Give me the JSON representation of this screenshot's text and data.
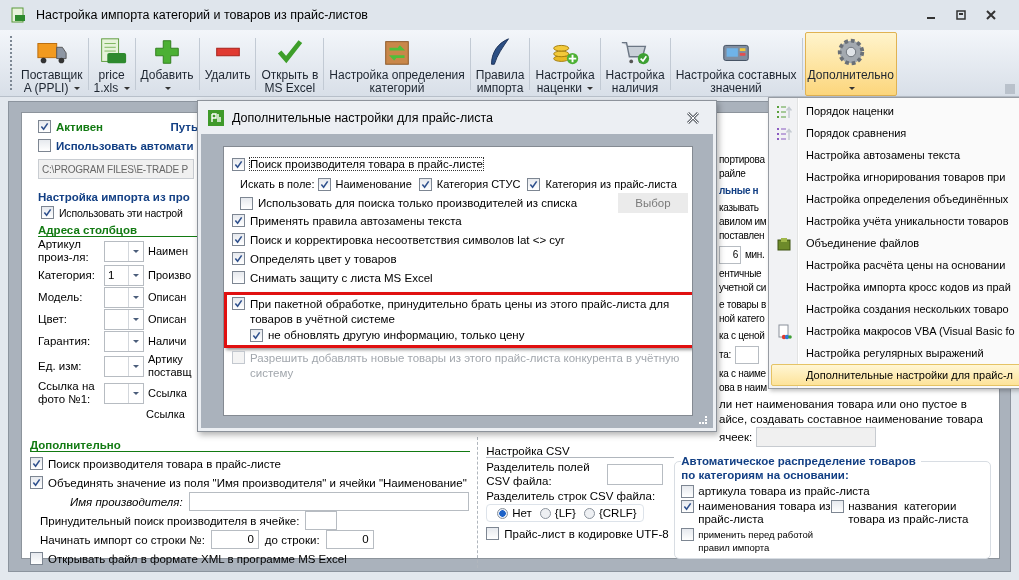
{
  "window": {
    "title": "Настройка импорта категорий и товаров из прайс-листов"
  },
  "toolbar": [
    {
      "lines": [
        "Поставщик",
        "A (PPLI)"
      ],
      "has_menu": true,
      "selected": false
    },
    {
      "lines": [
        "price",
        "1.xls"
      ],
      "has_menu": true,
      "selected": false
    },
    {
      "lines": [
        "Добавить"
      ],
      "has_menu": true,
      "selected": false
    },
    {
      "lines": [
        "Удалить"
      ],
      "has_menu": false,
      "selected": false
    },
    {
      "lines": [
        "Открыть в",
        "MS Excel"
      ],
      "has_menu": false,
      "selected": false
    },
    {
      "lines": [
        "Настройка определения",
        "категорий"
      ],
      "has_menu": false,
      "selected": false
    },
    {
      "lines": [
        "Правила",
        "импорта"
      ],
      "has_menu": false,
      "selected": false
    },
    {
      "lines": [
        "Настройка",
        "наценки"
      ],
      "has_menu": true,
      "selected": false
    },
    {
      "lines": [
        "Настройка",
        "наличия"
      ],
      "has_menu": false,
      "selected": false
    },
    {
      "lines": [
        "Настройка составных",
        "значений"
      ],
      "has_menu": false,
      "selected": false
    },
    {
      "lines": [
        "Дополнительно"
      ],
      "has_menu": true,
      "selected": true
    }
  ],
  "form": {
    "active": {
      "label": "Активен",
      "checked": true
    },
    "path_label": "Путь",
    "auto": {
      "label": "Использовать автомати",
      "checked": false,
      "path": "C:\\PROGRAM FILES\\E-TRADE P"
    },
    "import_title": "Настройка импорта из про",
    "use_settings": {
      "label": "Использовать эти настрой",
      "checked": true
    },
    "columns_heading": "Адреса столбцов",
    "columns": [
      {
        "label": "Артикул произ-ля:",
        "side": "Наимен"
      },
      {
        "label": "Категория:",
        "value": "1",
        "side": "Произво"
      },
      {
        "label": "Модель:",
        "side": "Описан"
      },
      {
        "label": "Цвет:",
        "side": "Описан"
      },
      {
        "label": "Гарантия:",
        "side": "Наличи"
      },
      {
        "label": "Ед. изм:",
        "side": "Артику поставщ"
      },
      {
        "label": "Ссылка на фото №1:",
        "side": "Ссылка"
      }
    ],
    "trailing_label": "Ссылка",
    "right_fragments": [
      {
        "kind": "text",
        "lines": [
          "портирова",
          "райле"
        ]
      },
      {
        "kind": "heading",
        "lines": [
          "льные н"
        ]
      },
      {
        "kind": "text",
        "lines": [
          "казывать",
          "авилом им",
          "поставлен"
        ]
      },
      {
        "kind": "number",
        "value": "6",
        "lines": [
          "мин."
        ]
      },
      {
        "kind": "text",
        "lines": [
          "ентичные",
          "учетной си"
        ]
      },
      {
        "kind": "text",
        "lines": [
          "е товары в",
          "ной катего"
        ]
      },
      {
        "kind": "text",
        "lines": [
          "ка с ценой"
        ]
      },
      {
        "kind": "field",
        "lines": [
          "та:"
        ]
      },
      {
        "kind": "text",
        "lines": [
          "ка с наиме",
          "ова в наим"
        ]
      }
    ],
    "composite_text": [
      "ли нет наименования товара или оно пустое в",
      "айсе, создавать составное наименование товара"
    ],
    "composite_field_label": "ячеек:",
    "extra_heading": "Дополнительно",
    "extra": {
      "search_maker": {
        "label": "Поиск производителя товара в прайс-листе",
        "checked": true
      },
      "merge": {
        "label": "Объединять значение из поля \"Имя производителя\" и ячейки \"Наименование\"",
        "checked": true
      },
      "maker_name_label": "Имя производителя:",
      "forced_search_label": "Принудительный поиск производителя в ячейке:",
      "start_label": "Начинать импорт со строки №:",
      "start_value": "0",
      "end_label": "до строки:",
      "end_value": "0",
      "xml": {
        "label": "Открывать файл в формате XML в программе MS Excel",
        "checked": false
      }
    },
    "csv": {
      "title": "Настройка CSV",
      "field_sep_label": "Разделитель полей CSV файла:",
      "row_sep_label": "Разделитель строк CSV файла:",
      "radios": [
        {
          "label": "Нет",
          "selected": true
        },
        {
          "label": "{LF}",
          "selected": false
        },
        {
          "label": "{CRLF}",
          "selected": false
        }
      ],
      "utf8": {
        "label": "Прайс-лист в кодировке UTF-8",
        "checked": false
      }
    },
    "auto_dist": {
      "title": "Автоматическое распределение товаров по категориям на основании:",
      "items": [
        {
          "label": "артикула товара из прайс-листа",
          "checked": false
        },
        {
          "label": "наименования товара из прайс-листа",
          "checked": true
        },
        {
          "label": "названия  категории товара из прайс-листа",
          "checked": false
        },
        {
          "label": "применить перед работой правил импорта",
          "checked": false
        }
      ]
    }
  },
  "dialog": {
    "title": "Дополнительные настройки для прайс-листа",
    "search": {
      "label": "Поиск производителя товара в прайс-листе",
      "checked": true
    },
    "fields_label": "Искать в поле:",
    "fields": [
      {
        "label": "Наименование",
        "checked": true
      },
      {
        "label": "Категория СТУС",
        "checked": true
      },
      {
        "label": "Категория из прайс-листа",
        "checked": true
      }
    ],
    "only_list": {
      "label": "Использовать для поиска только производителей из списка",
      "checked": false
    },
    "choose_button": "Выбор",
    "options": [
      {
        "label": "Применять правила автозамены текста",
        "checked": true,
        "disabled": false,
        "highlighted": false
      },
      {
        "label": "Поиск и корректировка несоответствия символов lat <> cyr",
        "checked": true,
        "disabled": false,
        "highlighted": false
      },
      {
        "label": "Определять цвет у товаров",
        "checked": true,
        "disabled": false,
        "highlighted": false
      },
      {
        "label": "Снимать защиту с листа MS Excel",
        "checked": false,
        "disabled": false,
        "highlighted": false
      },
      {
        "label": "При пакетной обработке, принудительно брать цены из этого прайс-листа для товаров в учётной системе",
        "checked": true,
        "disabled": false,
        "highlighted": true,
        "sub": {
          "label": "не обновлять другую информацию, только цену",
          "checked": true
        }
      },
      {
        "label": "Разрешить добавлять новые товары из этого прайс-листа конкурента в учётную систему",
        "checked": false,
        "disabled": true,
        "highlighted": false
      }
    ]
  },
  "menu": {
    "items": [
      {
        "label": "Порядок наценки",
        "selected": false
      },
      {
        "label": "Порядок сравнения",
        "selected": false
      },
      {
        "label": "Настройка автозамены текста",
        "selected": false
      },
      {
        "label": "Настройка игнорирования товаров при",
        "selected": false
      },
      {
        "label": "Настройка определения объединённых",
        "selected": false
      },
      {
        "label": "Настройка учёта уникальности товаров",
        "selected": false
      },
      {
        "label": "Объединение файлов",
        "selected": false
      },
      {
        "label": "Настройка расчёта цены на основании",
        "selected": false
      },
      {
        "label": "Настройка импорта кросс кодов из прай",
        "selected": false
      },
      {
        "label": "Настройка создания нескольких товаро",
        "selected": false
      },
      {
        "label": "Настройка макросов VBA (Visual Basic fo",
        "selected": false
      },
      {
        "label": "Настройка регулярных выражений",
        "selected": false
      },
      {
        "label": "Дополнительные настройки для прайс-л",
        "selected": true
      }
    ]
  }
}
